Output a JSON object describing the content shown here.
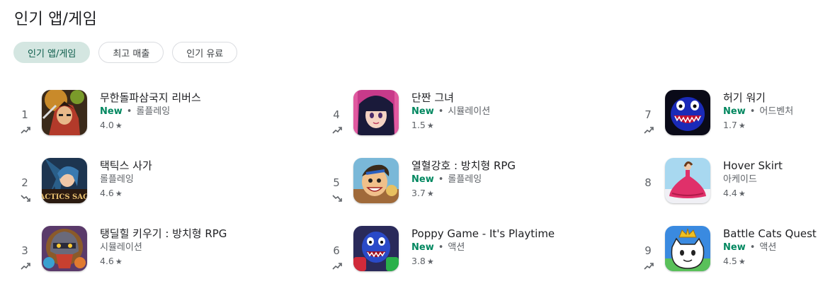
{
  "page": {
    "title": "인기 앱/게임"
  },
  "chips": [
    "인기 앱/게임",
    "최고 매출",
    "인기 유료"
  ],
  "new_label": "New",
  "separator": "•",
  "star_glyph": "★",
  "colors": {
    "new": "#01875f",
    "chip_active": "#d4e6e1"
  },
  "apps": [
    {
      "rank": "1",
      "name": "무한돌파삼국지 리버스",
      "is_new": true,
      "category": "롤플레잉",
      "rating": "4.0",
      "trend": "up",
      "icon": "rpg-warrior-icon"
    },
    {
      "rank": "2",
      "name": "택틱스 사가",
      "is_new": false,
      "category": "롤플레잉",
      "rating": "4.6",
      "trend": "down",
      "icon": "tactics-saga-icon"
    },
    {
      "rank": "3",
      "name": "탱딜힐 키우기 : 방치형 RPG",
      "is_new": false,
      "category": "시뮬레이션",
      "rating": "4.6",
      "trend": "up",
      "icon": "knight-helmet-icon"
    },
    {
      "rank": "4",
      "name": "단짠 그녀",
      "is_new": true,
      "category": "시뮬레이션",
      "rating": "1.5",
      "trend": "up",
      "icon": "anime-girl-icon"
    },
    {
      "rank": "5",
      "name": "열혈강호 : 방치형 RPG",
      "is_new": true,
      "category": "롤플레잉",
      "rating": "3.7",
      "trend": "down",
      "icon": "martial-hero-icon"
    },
    {
      "rank": "6",
      "name": "Poppy Game - It's Playtime",
      "is_new": true,
      "category": "액션",
      "rating": "3.8",
      "trend": "up",
      "icon": "blue-monster-icon"
    },
    {
      "rank": "7",
      "name": "허기 워기",
      "is_new": true,
      "category": "어드벤처",
      "rating": "1.7",
      "trend": "up",
      "icon": "huggy-wuggy-icon"
    },
    {
      "rank": "8",
      "name": "Hover Skirt",
      "is_new": false,
      "category": "아케이드",
      "rating": "4.4",
      "trend": "none",
      "icon": "skirt-girl-icon"
    },
    {
      "rank": "9",
      "name": "Battle Cats Quest",
      "is_new": true,
      "category": "액션",
      "rating": "4.5",
      "trend": "up",
      "icon": "battle-cat-icon"
    }
  ]
}
